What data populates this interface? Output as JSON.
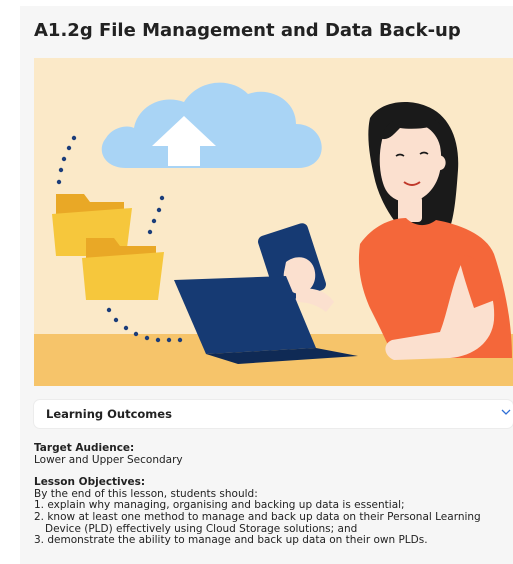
{
  "lesson": {
    "title": "A1.2g File Management and Data Back-up"
  },
  "accordion": {
    "label": "Learning Outcomes",
    "icon": "chevron-down-icon"
  },
  "details": {
    "audience_heading": "Target Audience:",
    "audience_value": "Lower and Upper Secondary",
    "objectives_heading": "Lesson Objectives:",
    "objectives_intro": "By the end of this lesson, students should:",
    "objectives": [
      "1. explain why managing, organising and backing up data is essential;",
      "2. know at least one method to manage and back up data on their Personal Learning Device (PLD) effectively using Cloud Storage solutions; and",
      "3. demonstrate the ability to manage and back up data on their own PLDs."
    ]
  },
  "colors": {
    "illustration_bg": "#fbe9c8",
    "desk": "#f6c46a",
    "cloud": "#a9d4f5",
    "folder": "#f6c73c",
    "laptop": "#163a73",
    "shirt": "#f4673a",
    "accent_link": "#2f6fd6"
  }
}
